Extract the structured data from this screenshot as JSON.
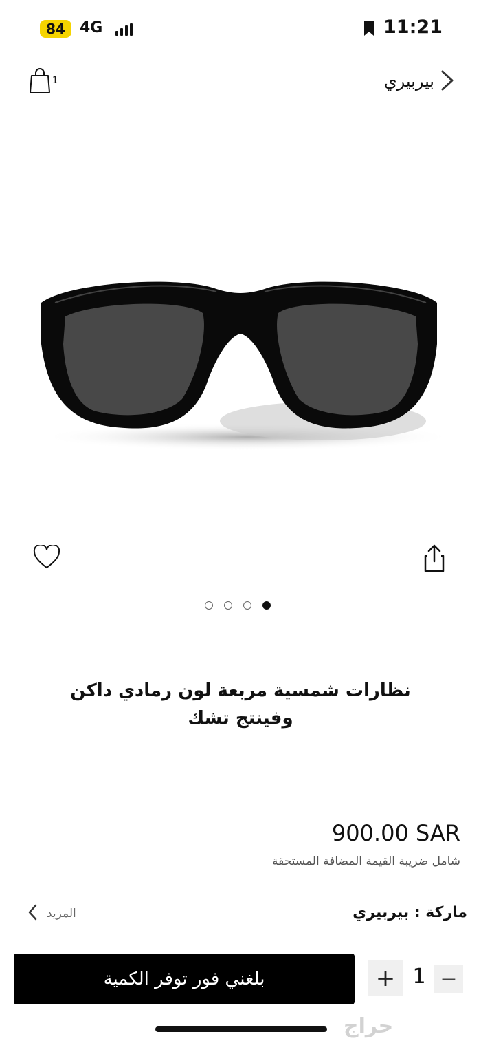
{
  "status_bar": {
    "battery": "84",
    "network": "4G",
    "time": "11:21"
  },
  "header": {
    "title": "بيربيري",
    "cart_count": "1"
  },
  "gallery": {
    "total_images": 4,
    "active_index": 3
  },
  "product": {
    "title": "نظارات شمسية مربعة لون رمادي داكن وفينتج تشك",
    "price": "900.00 SAR",
    "vat_note": "شامل ضريبة القيمة المضافة المستحقة",
    "brand_row": "ماركة : بيربيري",
    "more_label": "المزيد"
  },
  "actions": {
    "notify_label": "بلغني فور توفر الكمية",
    "quantity": "1"
  },
  "watermark": "حراج",
  "colors": {
    "primary": "#000000",
    "accent_battery": "#f5d400",
    "muted_text": "#555555"
  }
}
